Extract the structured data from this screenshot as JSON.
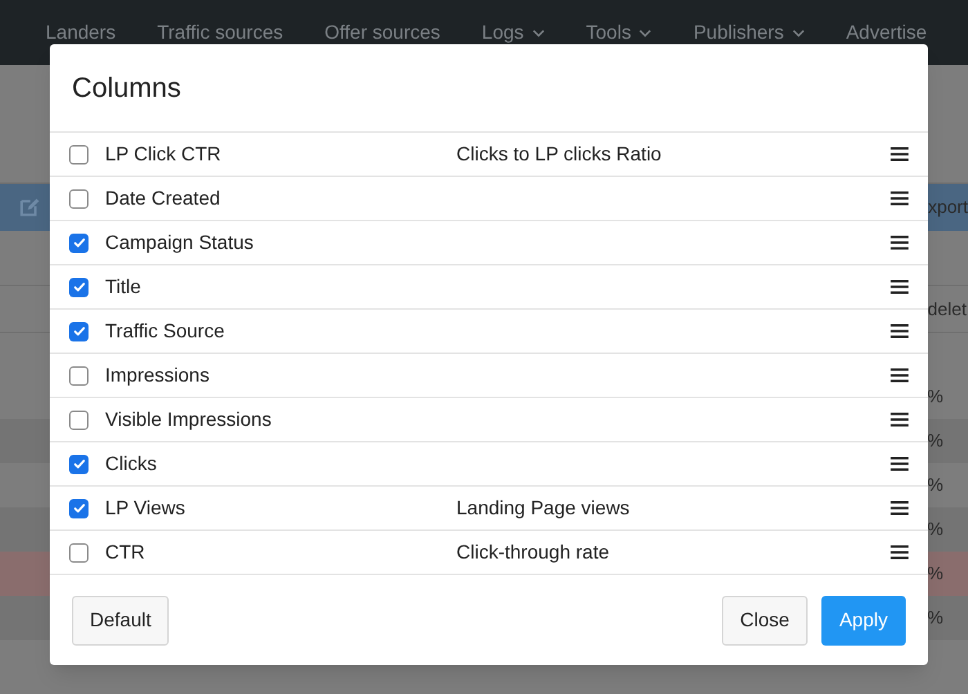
{
  "nav": [
    {
      "label": "Landers",
      "dropdown": false
    },
    {
      "label": "Traffic sources",
      "dropdown": false
    },
    {
      "label": "Offer sources",
      "dropdown": false
    },
    {
      "label": "Logs",
      "dropdown": true
    },
    {
      "label": "Tools",
      "dropdown": true
    },
    {
      "label": "Publishers",
      "dropdown": true
    },
    {
      "label": "Advertise",
      "dropdown": false
    }
  ],
  "background": {
    "export_fragment": "xport",
    "delete_fragment": "delet",
    "percent_cells": [
      "%",
      "%",
      "%",
      "%",
      "%",
      "%"
    ]
  },
  "dialog": {
    "title": "Columns",
    "rows": [
      {
        "name": "LP Click CTR",
        "description": "Clicks to LP clicks Ratio",
        "checked": false
      },
      {
        "name": "Date Created",
        "checked": false
      },
      {
        "name": "Campaign Status",
        "checked": true
      },
      {
        "name": "Title",
        "checked": true
      },
      {
        "name": "Traffic Source",
        "checked": true
      },
      {
        "name": "Impressions",
        "checked": false
      },
      {
        "name": "Visible Impressions",
        "checked": false
      },
      {
        "name": "Clicks",
        "checked": true
      },
      {
        "name": "LP Views",
        "description": "Landing Page views",
        "checked": true
      },
      {
        "name": "CTR",
        "description": "Click-through rate",
        "checked": false
      }
    ],
    "buttons": {
      "default": "Default",
      "close": "Close",
      "apply": "Apply"
    }
  }
}
